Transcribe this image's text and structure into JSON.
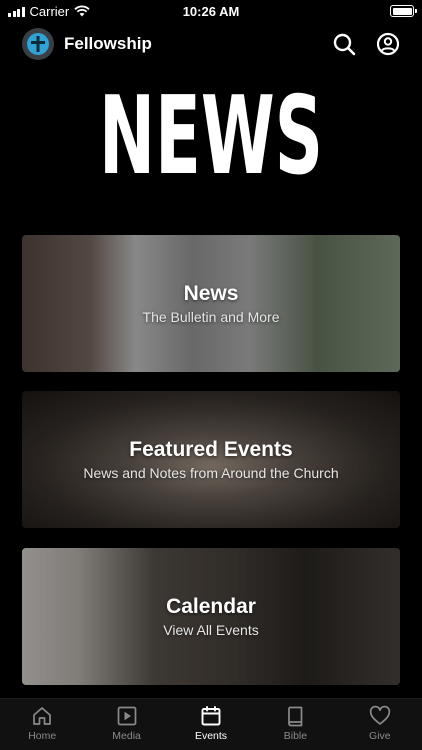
{
  "status_bar": {
    "carrier": "Carrier",
    "time": "10:26 AM"
  },
  "header": {
    "app_name": "Fellowship",
    "logo_color": "#2fa3d6"
  },
  "page": {
    "title": "NEWS"
  },
  "cards": [
    {
      "title": "News",
      "subtitle": "The Bulletin and More"
    },
    {
      "title": "Featured Events",
      "subtitle": "News and Notes from Around the Church"
    },
    {
      "title": "Calendar",
      "subtitle": "View All Events"
    }
  ],
  "tabs": [
    {
      "label": "Home",
      "icon": "home-icon"
    },
    {
      "label": "Media",
      "icon": "play-icon"
    },
    {
      "label": "Events",
      "icon": "calendar-icon",
      "active": true
    },
    {
      "label": "Bible",
      "icon": "book-icon"
    },
    {
      "label": "Give",
      "icon": "heart-icon"
    }
  ],
  "colors": {
    "background": "#000000",
    "tab_inactive": "#8a8a8a",
    "tab_active": "#ffffff"
  }
}
